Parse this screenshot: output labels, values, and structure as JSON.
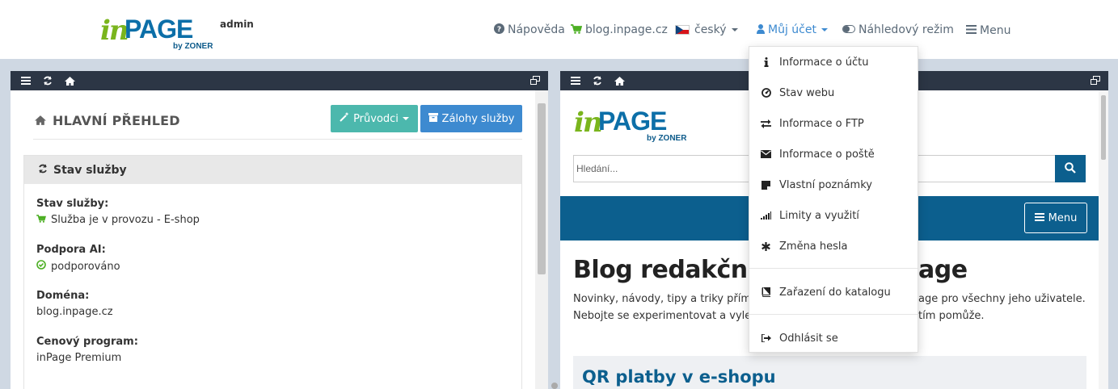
{
  "header": {
    "logo_in": "in",
    "logo_page": "PAGE",
    "logo_by": "by ZONER",
    "logo_admin": "admin",
    "nav": {
      "help": "Nápověda",
      "shop": "blog.inpage.cz",
      "language": "český",
      "account": "Můj účet",
      "preview": "Náhledový režim",
      "menu": "Menu"
    }
  },
  "account_menu": {
    "items": [
      {
        "label": "Informace o účtu",
        "icon": "info-icon"
      },
      {
        "label": "Stav webu",
        "icon": "dashboard-icon"
      },
      {
        "label": "Informace o FTP",
        "icon": "exchange-icon"
      },
      {
        "label": "Informace o poště",
        "icon": "envelope-icon"
      },
      {
        "label": "Vlastní poznámky",
        "icon": "sticky-note-icon"
      },
      {
        "label": "Limity a využití",
        "icon": "signal-icon"
      },
      {
        "label": "Změna hesla",
        "icon": "asterisk-icon"
      },
      {
        "label": "Zařazení do katalogu",
        "icon": "book-icon"
      },
      {
        "label": "Odhlásit se",
        "icon": "sign-out-icon"
      }
    ]
  },
  "left_panel": {
    "title": "HLAVNÍ PŘEHLED",
    "btn_guides": "Průvodci",
    "btn_backups": "Zálohy služby",
    "card_title": "Stav služby",
    "fields": [
      {
        "label": "Stav služby:",
        "value": "Služba je v provozu - E-shop"
      },
      {
        "label": "Podpora AI:",
        "value": "podporováno"
      },
      {
        "label": "Doména:",
        "value": "blog.inpage.cz"
      },
      {
        "label": "Cenový program:",
        "value": "inPage Premium"
      }
    ]
  },
  "right_panel": {
    "logo_in": "in",
    "logo_page": "PAGE",
    "logo_by": "by ZONER",
    "search_placeholder": "Hledání...",
    "menu_label": "Menu",
    "blog_heading_left": "Blog redakčního",
    "blog_heading_right": "age",
    "blog_line1_left": "Novinky, návody, tipy a triky přímo o",
    "blog_line1_right": "age pro všechny jeho uživatele.",
    "blog_line2_left": "Nebojte se experimentovat a vylepš",
    "blog_line2_right": "tím pomůže.",
    "post_title": "QR platby v e-shopu"
  },
  "colors": {
    "teal_button": "#4cb8ad",
    "blue_button": "#3d8ad0",
    "brand_blue": "#0c5f8e",
    "green": "#4caf23",
    "panel_bar": "#2c3645"
  }
}
